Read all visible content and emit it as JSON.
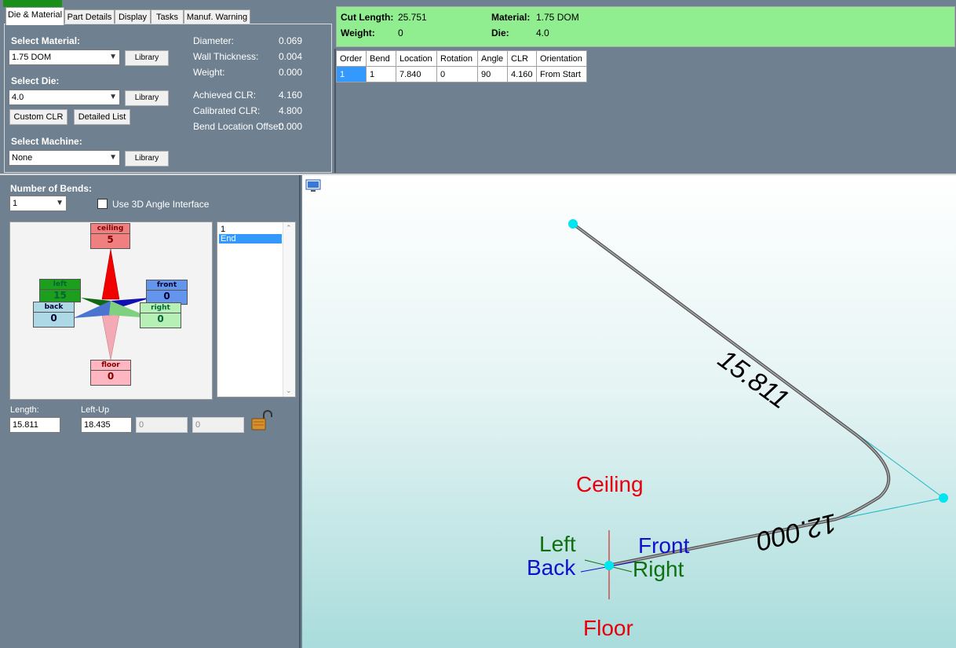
{
  "tabs": [
    "Die & Material",
    "Part Details",
    "Display",
    "Tasks",
    "Manuf. Warning"
  ],
  "material": {
    "select_material_label": "Select Material:",
    "material_value": "1.75 DOM",
    "library_label": "Library",
    "select_die_label": "Select Die:",
    "die_value": "4.0",
    "custom_clr_label": "Custom CLR",
    "detailed_list_label": "Detailed List",
    "select_machine_label": "Select Machine:",
    "machine_value": "None",
    "props": [
      {
        "label": "Diameter:",
        "value": "0.069"
      },
      {
        "label": "Wall Thickness:",
        "value": "0.004"
      },
      {
        "label": "Weight:",
        "value": "0.000"
      },
      {
        "label": "Achieved CLR:",
        "value": "4.160"
      },
      {
        "label": "Calibrated CLR:",
        "value": "4.800"
      },
      {
        "label": "Bend Location Offset:",
        "value": "0.000"
      }
    ]
  },
  "summary": {
    "cut_length_label": "Cut Length:",
    "cut_length": "25.751",
    "material_label": "Material:",
    "material": "1.75 DOM",
    "weight_label": "Weight:",
    "weight": "0",
    "die_label": "Die:",
    "die": "4.0"
  },
  "bend_table": {
    "columns": [
      "Order",
      "Bend",
      "Location",
      "Rotation",
      "Angle",
      "CLR",
      "Orientation"
    ],
    "rows": [
      [
        "1",
        "1",
        "7.840",
        "0",
        "90",
        "4.160",
        "From Start"
      ]
    ]
  },
  "bends": {
    "number_label": "Number of Bends:",
    "number_value": "1",
    "use_3d_label": "Use 3D Angle Interface",
    "directions": {
      "ceiling": {
        "label": "ceiling",
        "value": "5"
      },
      "left": {
        "label": "left",
        "value": "15"
      },
      "front": {
        "label": "front",
        "value": "0"
      },
      "back": {
        "label": "back",
        "value": "0"
      },
      "right": {
        "label": "right",
        "value": "0"
      },
      "floor": {
        "label": "floor",
        "value": "0"
      }
    },
    "list_items": [
      "1",
      "End"
    ],
    "length_label": "Length:",
    "length_value": "15.811",
    "leftup_label": "Left-Up",
    "leftup_value": "18.435",
    "field3_value": "0",
    "field4_value": "0"
  },
  "viewport": {
    "dim1": "15.811",
    "dim2": "12.000",
    "ceiling": "Ceiling",
    "floor": "Floor",
    "left": "Left",
    "front": "Front",
    "back": "Back",
    "right": "Right"
  },
  "colors": {
    "summary_bg": "#90ee90",
    "panel_bg": "#6f8091",
    "node": "#00e5f0",
    "ceiling": "#e8000c",
    "left": "#107010",
    "front": "#1010d0"
  }
}
